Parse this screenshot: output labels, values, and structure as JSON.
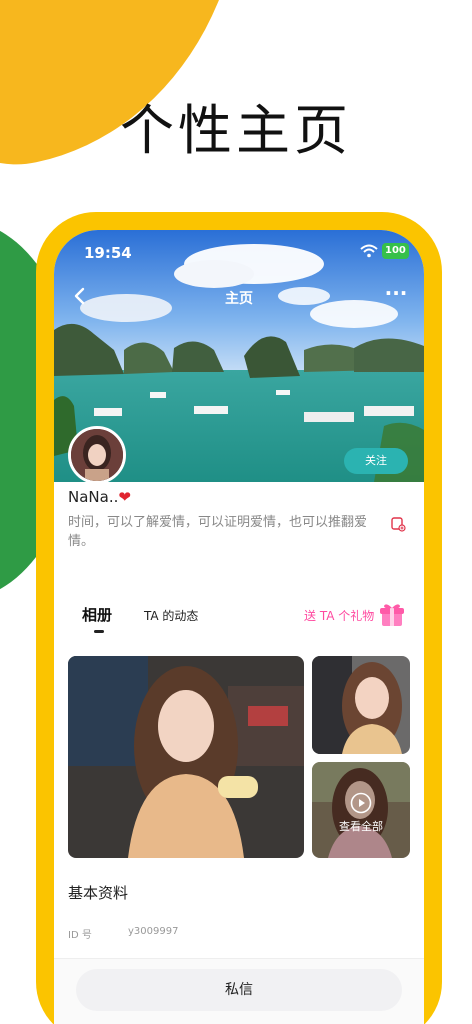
{
  "promo": {
    "title": "个性主页"
  },
  "status_bar": {
    "time": "19:54",
    "battery": "100"
  },
  "nav": {
    "title": "主页",
    "more": "···"
  },
  "profile": {
    "username": "NaNa..",
    "heart": "❤",
    "bio": "时间，可以了解爱情，可以证明爱情，也可以推翻爱情。",
    "follow_label": "关注"
  },
  "tabs": {
    "album": "相册",
    "moments": "TA 的动态",
    "gift": "送 TA 个礼物"
  },
  "gallery": {
    "view_all": "查看全部"
  },
  "basic_info": {
    "title": "基本资料",
    "id_label": "ID 号",
    "id_value": "y3009997"
  },
  "bottom": {
    "message_label": "私信"
  },
  "colors": {
    "phone_frame": "#fbc400",
    "accent_teal": "#2bb3b1",
    "gift_pink": "#ff4aa0",
    "blob_yellow": "#f7b71e",
    "blob_green": "#2f9b45",
    "battery_green": "#36c04a"
  },
  "icons": [
    "back-arrow-icon",
    "more-icon",
    "wifi-icon",
    "report-icon",
    "gift-box-icon",
    "play-icon"
  ]
}
